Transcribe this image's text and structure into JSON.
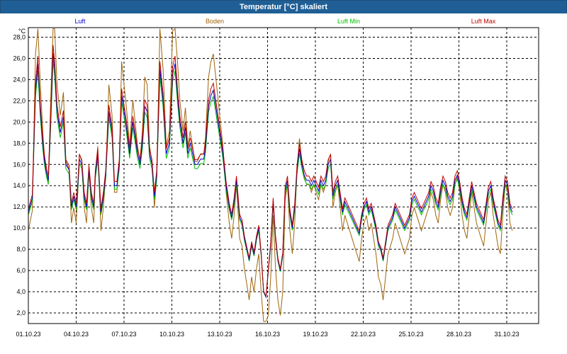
{
  "window": {
    "title": "Temperatur [°C] skaliert"
  },
  "chart_data": {
    "type": "line",
    "title": "Temperatur [°C] skaliert",
    "ylabel": "°C",
    "xlabel": "",
    "ylim": [
      1.0,
      28.9
    ],
    "y_ticks": [
      "2,0",
      "4,0",
      "6,0",
      "8,0",
      "10,0",
      "12,0",
      "14,0",
      "16,0",
      "18,0",
      "20,0",
      "22,0",
      "24,0",
      "26,0",
      "28,0"
    ],
    "x_ticks": [
      "01.10.23",
      "04.10.23",
      "07.10.23",
      "10.10.23",
      "13.10.23",
      "16.10.23",
      "19.10.23",
      "22.10.23",
      "25.10.23",
      "28.10.23",
      "31.10.23"
    ],
    "x_start": "2023-10-01",
    "x_end": "2023-11-01",
    "grid": true,
    "legend_position": "top",
    "x_day": [
      0,
      0.25,
      0.45,
      0.6,
      0.75,
      0.9,
      1.0,
      1.1,
      1.25,
      1.4,
      1.55,
      1.65,
      1.8,
      2.0,
      2.2,
      2.35,
      2.55,
      2.7,
      2.85,
      3.0,
      3.1,
      3.2,
      3.35,
      3.5,
      3.65,
      3.8,
      3.95,
      4.1,
      4.2,
      4.35,
      4.55,
      4.7,
      4.85,
      5.05,
      5.25,
      5.4,
      5.55,
      5.7,
      5.85,
      6.0,
      6.15,
      6.35,
      6.55,
      6.7,
      6.85,
      7.0,
      7.15,
      7.3,
      7.45,
      7.6,
      7.75,
      7.9,
      8.05,
      8.25,
      8.45,
      8.65,
      8.85,
      9.05,
      9.2,
      9.35,
      9.5,
      9.7,
      9.85,
      10.0,
      10.15,
      10.3,
      10.45,
      10.6,
      10.8,
      11.0,
      11.1,
      11.3,
      11.45,
      11.6,
      11.8,
      12.0,
      12.2,
      12.4,
      12.6,
      12.75,
      12.9,
      13.05,
      13.25,
      13.4,
      13.55,
      13.7,
      13.85,
      14.0,
      14.15,
      14.3,
      14.45,
      14.6,
      14.75,
      14.9,
      15.05,
      15.2,
      15.35,
      15.5,
      15.65,
      15.8,
      15.95,
      16.1,
      16.25,
      16.4,
      16.55,
      16.7,
      16.85,
      17.0,
      17.15,
      17.3,
      17.45,
      17.6,
      17.75,
      17.9,
      18.05,
      18.2,
      18.35,
      18.5,
      18.65,
      18.8,
      18.95,
      19.1,
      19.25,
      19.4,
      19.55,
      19.7,
      19.85,
      20.0,
      20.15,
      20.3,
      20.45,
      20.6,
      20.75,
      20.9,
      21.05,
      21.2,
      21.35,
      21.5,
      21.65,
      21.8,
      21.95,
      22.1,
      22.25,
      22.4,
      22.55,
      22.7,
      22.85,
      23.0,
      23.15,
      23.3,
      23.45,
      23.6,
      23.75,
      23.9,
      24.05,
      24.2,
      24.35,
      24.5,
      24.65,
      24.8,
      24.95,
      25.1,
      25.25,
      25.4,
      25.55,
      25.7,
      25.85,
      26.0,
      26.15,
      26.3,
      26.45,
      26.6,
      26.75,
      26.9,
      27.05,
      27.2,
      27.35,
      27.5,
      27.65,
      27.8,
      27.95,
      28.1,
      28.25,
      28.4,
      28.55,
      28.7,
      28.85,
      29.0,
      29.15,
      29.3,
      29.45,
      29.6,
      29.75,
      29.9,
      30.05,
      30.2,
      30.35,
      30.5,
      30.65,
      30.8,
      30.95,
      31.1,
      31.25,
      31.45,
      31.6,
      31.8,
      32.0
    ],
    "series": [
      {
        "name": "Luft",
        "color": "#0000c8",
        "offset": 0.0,
        "amp": 1.0
      },
      {
        "name": "Boden",
        "color": "#a0640a",
        "offset": -0.4,
        "amp": 1.45
      },
      {
        "name": "Luft Min",
        "color": "#00c000",
        "offset": -0.35,
        "amp": 0.97
      },
      {
        "name": "Luft Max",
        "color": "#c00000",
        "offset": 0.4,
        "amp": 1.03
      }
    ],
    "base_values": [
      11.5,
      12.8,
      23.0,
      25.5,
      21.0,
      18.0,
      16.5,
      15.5,
      14.5,
      20.0,
      26.5,
      25.0,
      21.0,
      19.0,
      20.5,
      16.0,
      15.5,
      12.0,
      13.0,
      12.0,
      14.0,
      16.5,
      16.0,
      13.0,
      12.0,
      15.5,
      13.0,
      12.0,
      15.0,
      17.0,
      11.5,
      13.0,
      15.0,
      21.0,
      19.0,
      14.0,
      14.0,
      16.0,
      22.5,
      21.0,
      19.5,
      17.0,
      20.0,
      18.5,
      17.0,
      16.0,
      18.0,
      21.5,
      21.0,
      17.0,
      16.0,
      13.0,
      15.0,
      25.0,
      22.0,
      17.0,
      18.0,
      24.5,
      25.5,
      22.5,
      20.0,
      18.0,
      19.5,
      17.0,
      18.0,
      17.0,
      16.0,
      16.0,
      16.5,
      16.5,
      17.5,
      21.5,
      22.5,
      23.0,
      21.0,
      19.0,
      17.0,
      14.0,
      12.0,
      11.0,
      12.5,
      14.5,
      11.0,
      10.5,
      9.0,
      8.0,
      7.0,
      8.5,
      7.5,
      9.0,
      10.0,
      7.5,
      4.0,
      3.5,
      6.0,
      8.5,
      12.5,
      9.0,
      7.0,
      6.0,
      7.5,
      13.5,
      14.5,
      11.5,
      10.0,
      12.0,
      15.5,
      17.5,
      16.0,
      15.0,
      14.5,
      14.5,
      14.0,
      14.5,
      14.0,
      13.5,
      14.5,
      14.0,
      14.5,
      16.0,
      16.5,
      13.0,
      14.0,
      14.5,
      13.0,
      11.5,
      12.5,
      12.0,
      11.5,
      11.0,
      10.5,
      10.0,
      9.5,
      11.0,
      12.0,
      12.5,
      11.5,
      12.0,
      11.0,
      10.0,
      8.5,
      8.0,
      7.0,
      8.5,
      10.0,
      10.5,
      11.0,
      12.0,
      11.5,
      11.0,
      10.5,
      10.0,
      10.5,
      11.0,
      12.5,
      13.0,
      12.5,
      12.0,
      11.5,
      12.0,
      12.5,
      13.0,
      14.0,
      13.5,
      12.5,
      12.0,
      13.5,
      14.5,
      14.0,
      13.0,
      12.5,
      13.0,
      14.5,
      15.0,
      14.0,
      12.5,
      11.5,
      11.0,
      12.5,
      14.0,
      13.0,
      12.0,
      11.5,
      11.0,
      10.5,
      12.0,
      13.5,
      14.0,
      12.5,
      11.5,
      10.5,
      10.0,
      12.5,
      14.5,
      14.0,
      12.0,
      11.5
    ]
  }
}
